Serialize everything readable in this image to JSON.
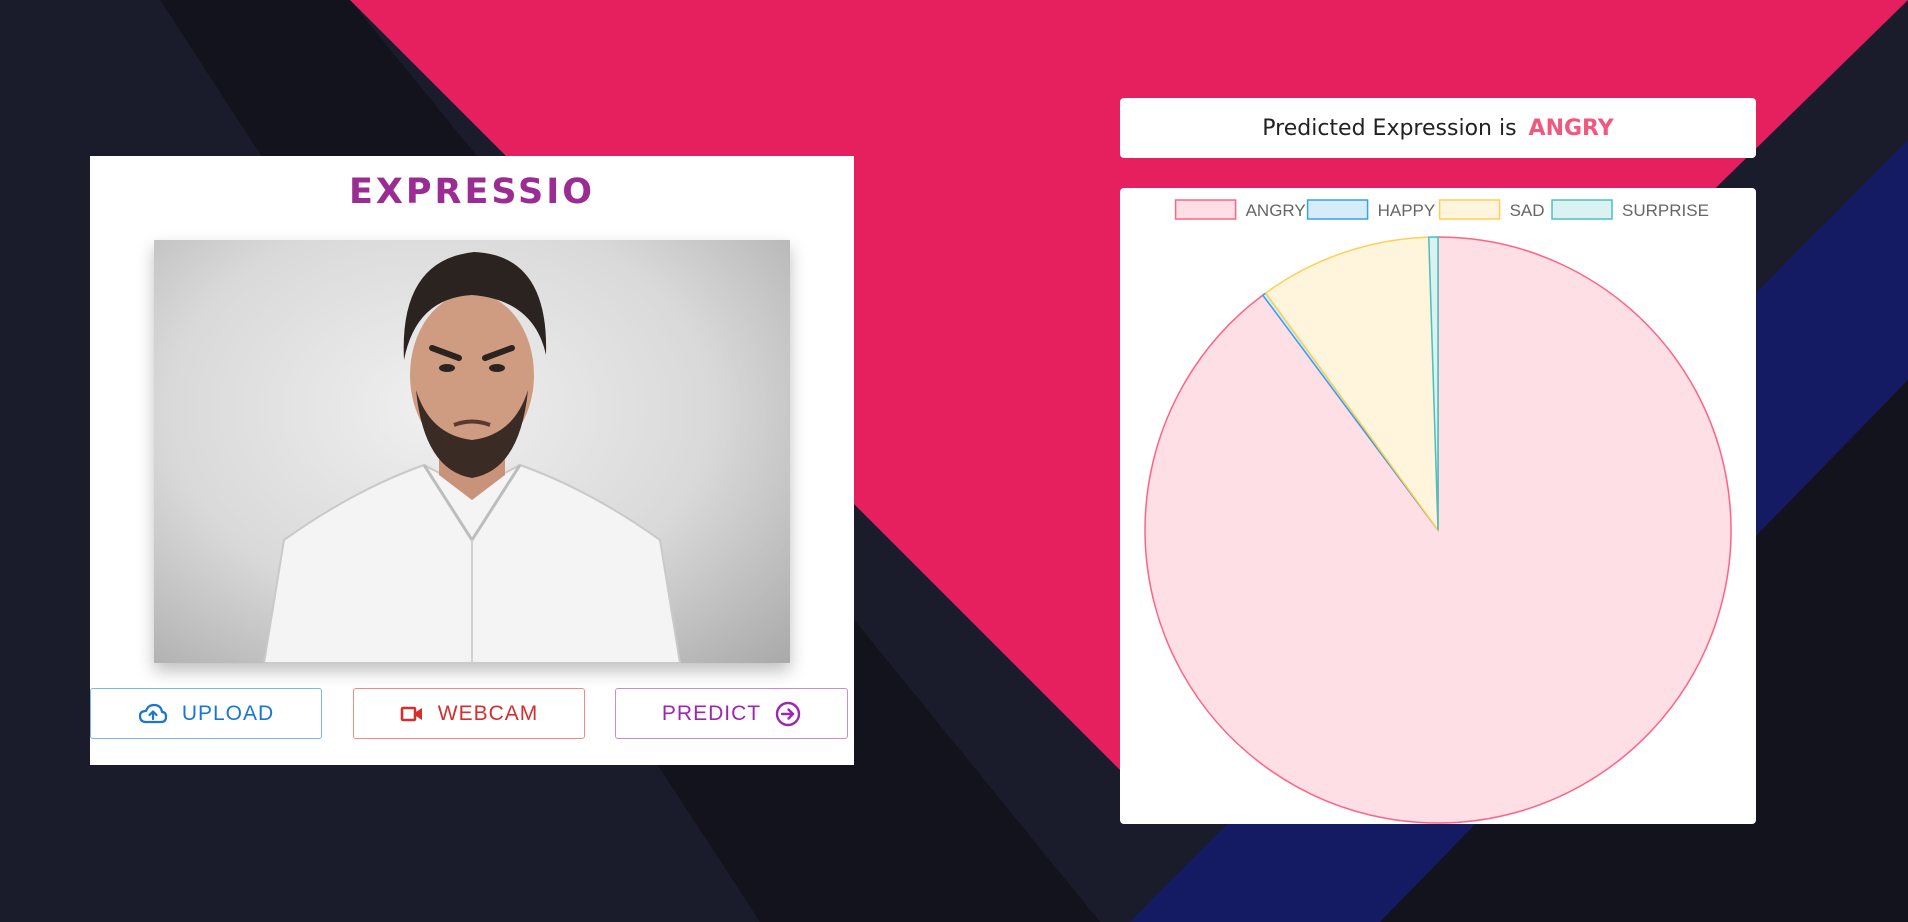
{
  "app": {
    "title": "EXPRESSIO"
  },
  "buttons": {
    "upload": "UPLOAD",
    "webcam": "WEBCAM",
    "predict": "PREDICT"
  },
  "icons": {
    "upload": "cloud-upload-icon",
    "webcam": "videocam-icon",
    "predict": "arrow-circle-right-icon"
  },
  "prediction": {
    "label": "Predicted Expression is",
    "value": "ANGRY"
  },
  "colors": {
    "background": "#1b1c2b",
    "accent_pink": "#e61f5e",
    "accent_navy": "#151b63",
    "title_purple": "#9b2c93"
  },
  "chart_data": {
    "type": "pie",
    "title": "",
    "legend_position": "top",
    "labels": [
      "ANGRY",
      "HAPPY",
      "SAD",
      "SURPRISE"
    ],
    "values": [
      89.8,
      0.2,
      9.5,
      0.5
    ],
    "colors": [
      {
        "fill": "#ffdfe6",
        "border": "#ff6384"
      },
      {
        "fill": "#d7ecfb",
        "border": "#36a2eb"
      },
      {
        "fill": "#fff5dd",
        "border": "#ffce56"
      },
      {
        "fill": "#dbf2f2",
        "border": "#4bc0c0"
      }
    ]
  }
}
